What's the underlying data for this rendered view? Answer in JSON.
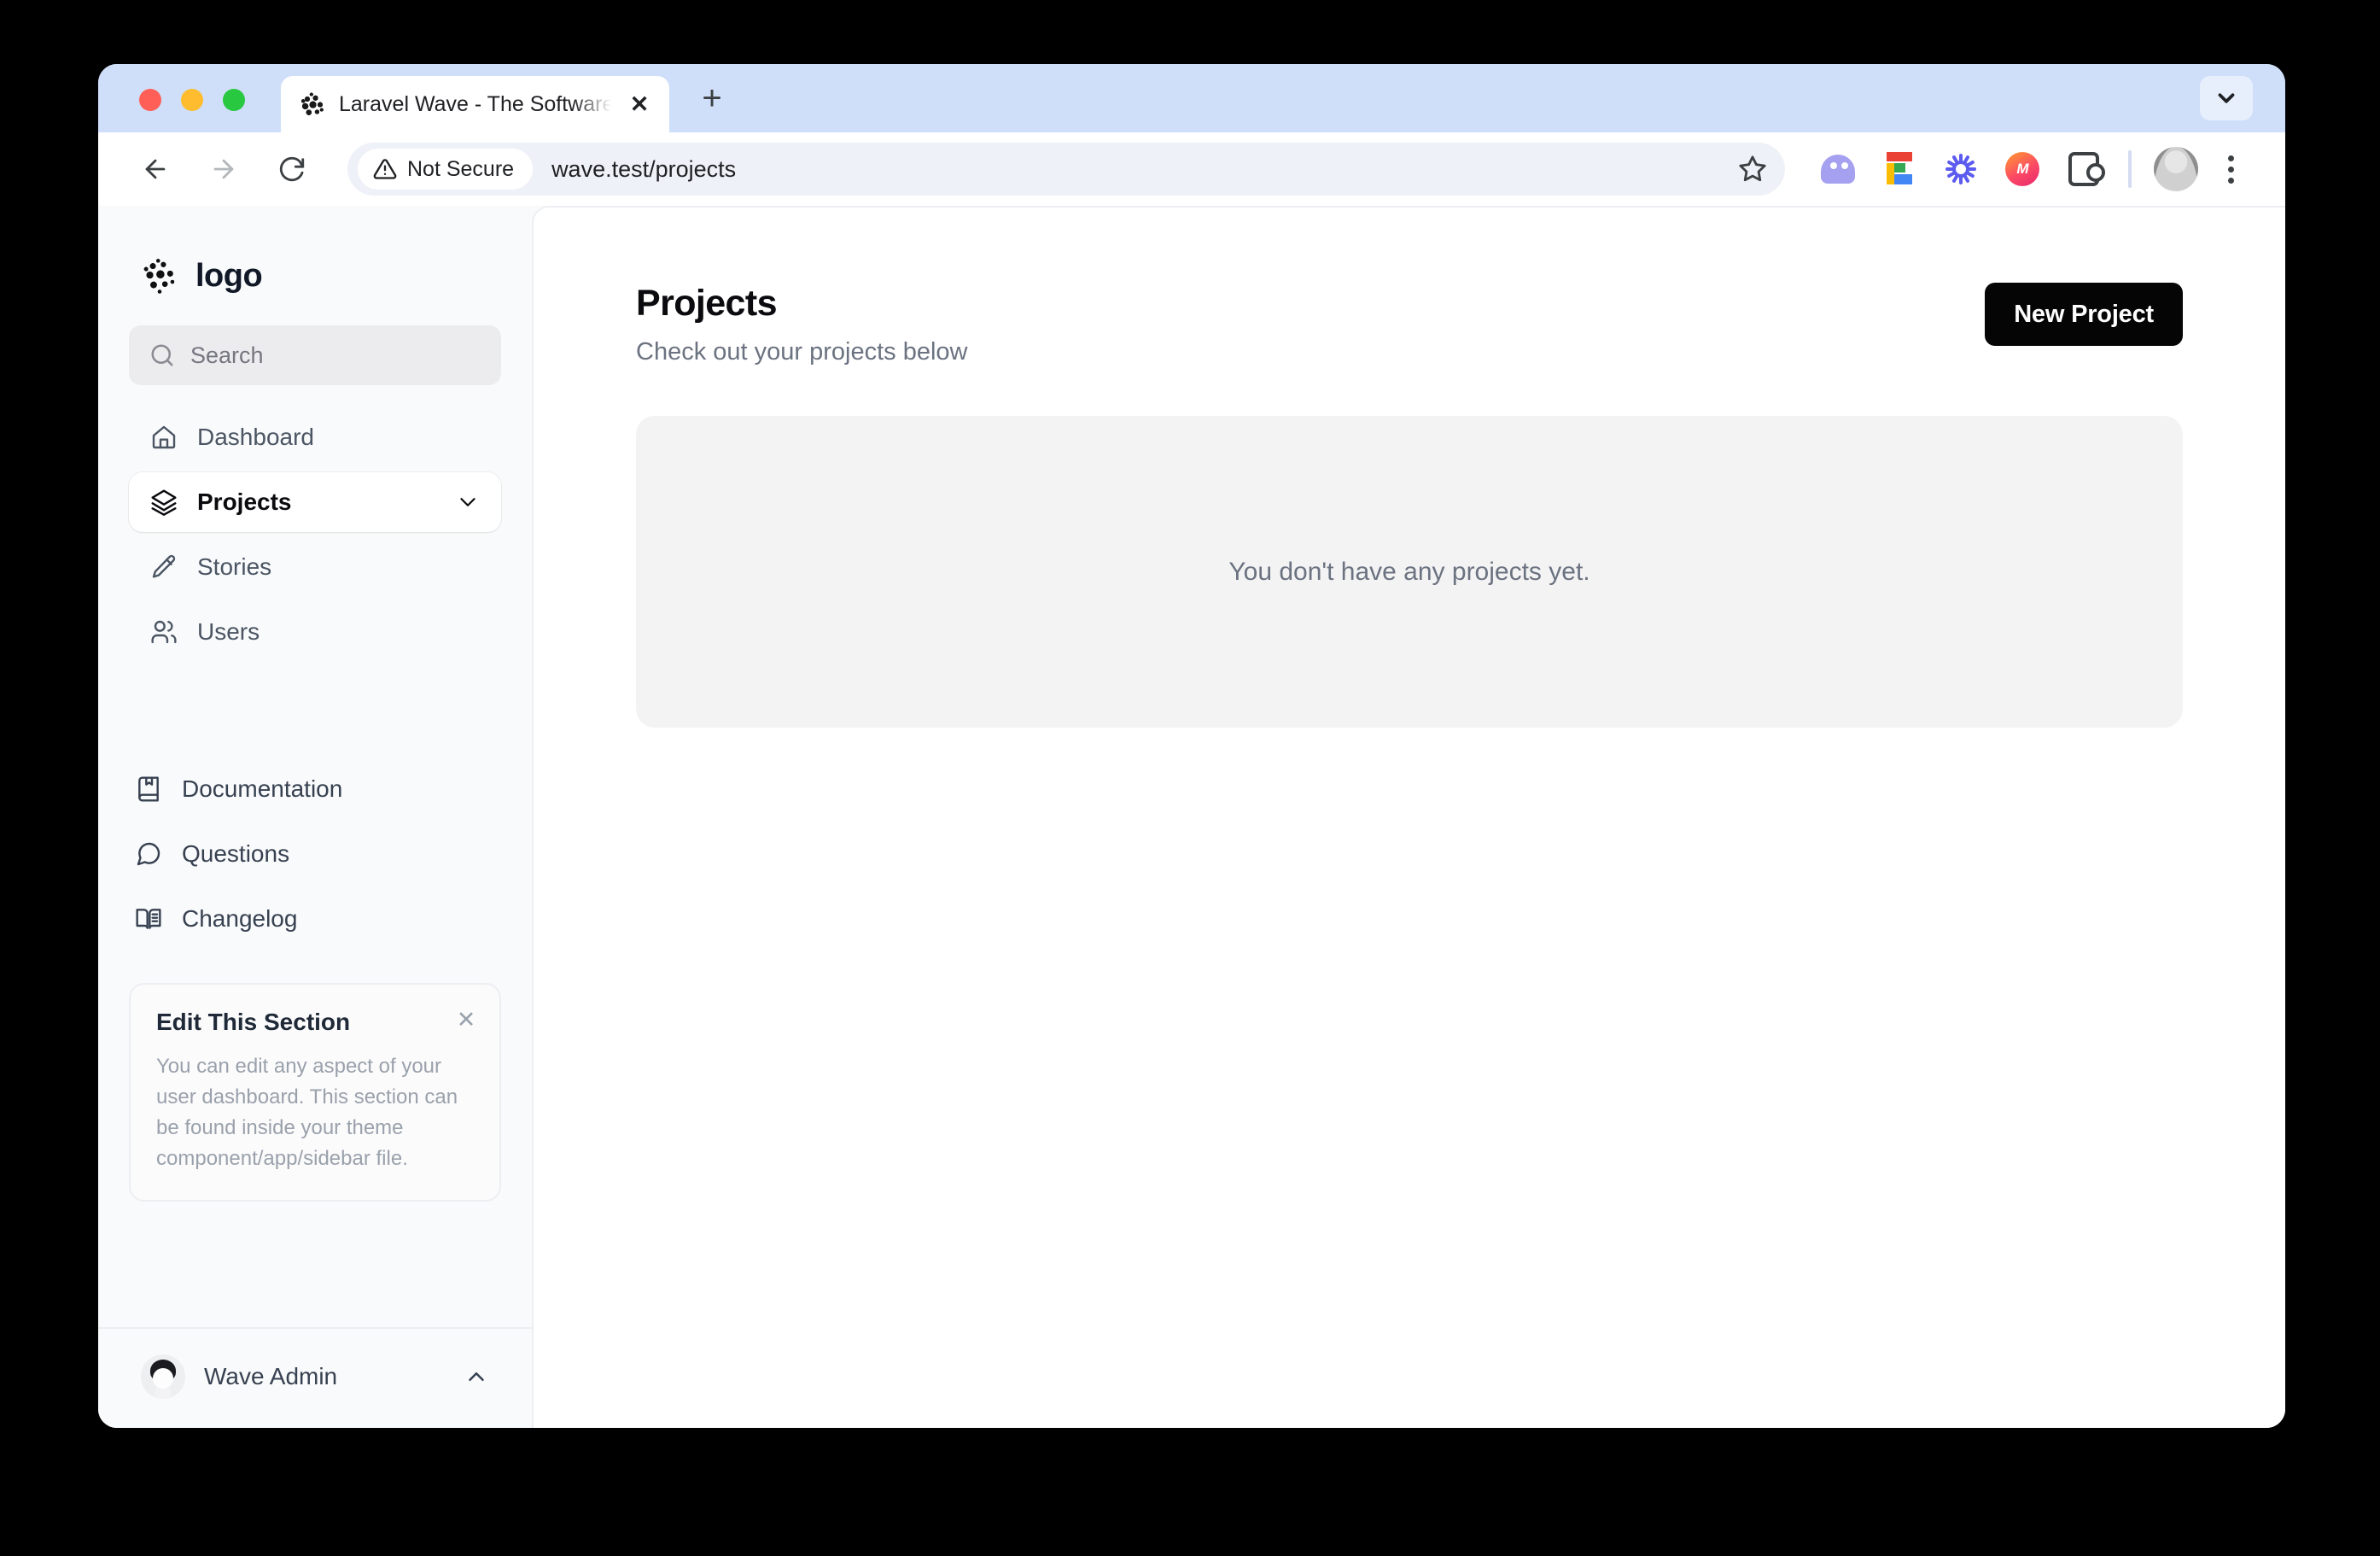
{
  "browser": {
    "tab": {
      "title": "Laravel Wave - The Software a",
      "favicon": "halftone-sphere-icon",
      "close_label": "✕"
    },
    "new_tab_label": "+",
    "tabstrip_chevron": "chevron-down-icon",
    "toolbar": {
      "back": "back-arrow-icon",
      "forward": "forward-arrow-icon",
      "reload": "reload-icon",
      "security_label": "Not Secure",
      "security_icon": "warning-triangle-icon",
      "url": "wave.test/projects",
      "bookmark": "star-icon",
      "extensions": [
        {
          "name": "ghost-extension-icon"
        },
        {
          "name": "figma-extension-icon"
        },
        {
          "name": "burst-extension-icon"
        },
        {
          "name": "m-circle-extension-icon"
        },
        {
          "name": "puzzle-extensions-icon"
        }
      ],
      "profile": "profile-avatar",
      "menu": "three-dot-menu-icon"
    }
  },
  "sidebar": {
    "brand": {
      "name": "logo",
      "mark": "halftone-sphere-logo"
    },
    "search": {
      "placeholder": "Search",
      "value": "",
      "icon": "search-icon"
    },
    "nav": [
      {
        "label": "Dashboard",
        "icon": "home-icon",
        "active": false,
        "expandable": false
      },
      {
        "label": "Projects",
        "icon": "layers-icon",
        "active": true,
        "expandable": true
      },
      {
        "label": "Stories",
        "icon": "pencil-icon",
        "active": false,
        "expandable": false
      },
      {
        "label": "Users",
        "icon": "users-icon",
        "active": false,
        "expandable": false
      }
    ],
    "nav_secondary": [
      {
        "label": "Documentation",
        "icon": "book-bookmark-icon"
      },
      {
        "label": "Questions",
        "icon": "chat-bubble-icon"
      },
      {
        "label": "Changelog",
        "icon": "open-book-icon"
      }
    ],
    "edit_card": {
      "title": "Edit This Section",
      "body": "You can edit any aspect of your user dashboard. This section can be found inside your theme component/app/sidebar file.",
      "close_label": "✕"
    },
    "footer": {
      "user_name": "Wave Admin",
      "avatar": "user-avatar",
      "chevron": "chevron-up-icon"
    }
  },
  "main": {
    "title": "Projects",
    "subtitle": "Check out your projects below",
    "new_project_label": "New Project",
    "empty_state_text": "You don't have any projects yet."
  },
  "colors": {
    "accent": "#050505",
    "tabstrip": "#cfdffa",
    "sidebar_bg": "#f9fafb",
    "empty_card": "#f3f3f4"
  }
}
